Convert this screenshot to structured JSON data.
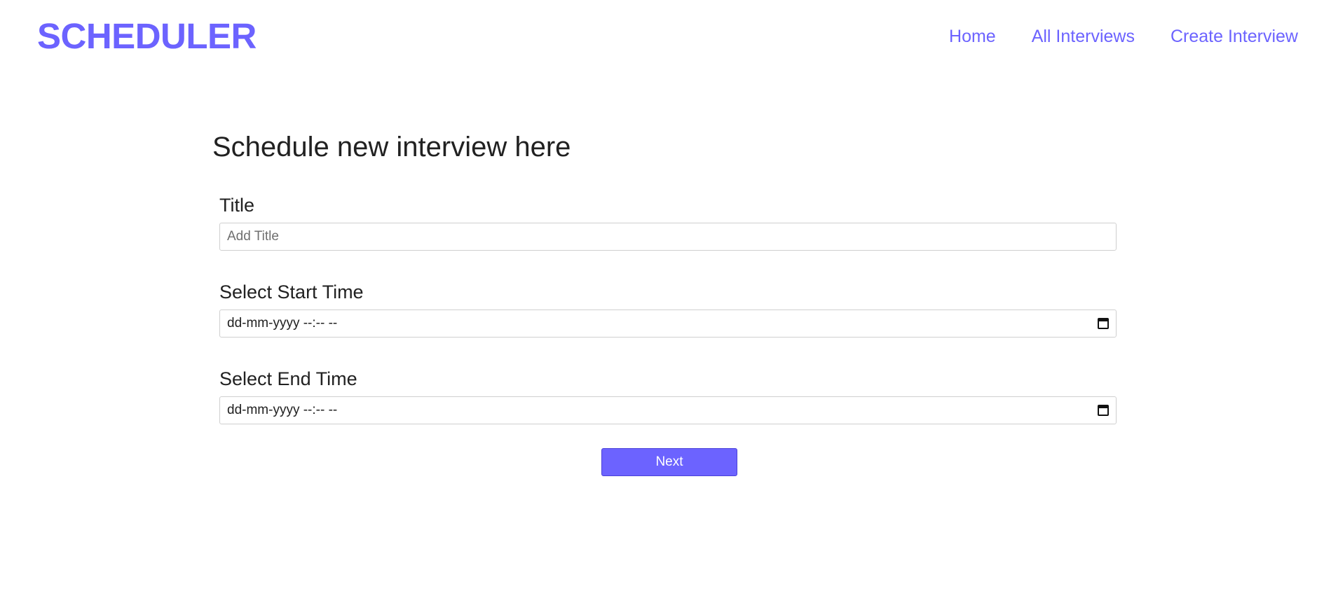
{
  "brand": {
    "name": "SCHEDULER"
  },
  "nav": {
    "items": [
      {
        "label": "Home"
      },
      {
        "label": "All Interviews"
      },
      {
        "label": "Create Interview"
      }
    ]
  },
  "form": {
    "heading": "Schedule new interview here",
    "title_field": {
      "label": "Title",
      "placeholder": "Add Title",
      "value": ""
    },
    "start_field": {
      "label": "Select Start Time",
      "display": "dd-mm-yyyy --:-- --"
    },
    "end_field": {
      "label": "Select End Time",
      "display": "dd-mm-yyyy --:-- --"
    },
    "submit_label": "Next"
  },
  "colors": {
    "accent": "#6c63ff",
    "text": "#212121",
    "border": "#cfcfcf",
    "background": "#ffffff"
  },
  "icons": {
    "datetime": "calendar-icon"
  }
}
